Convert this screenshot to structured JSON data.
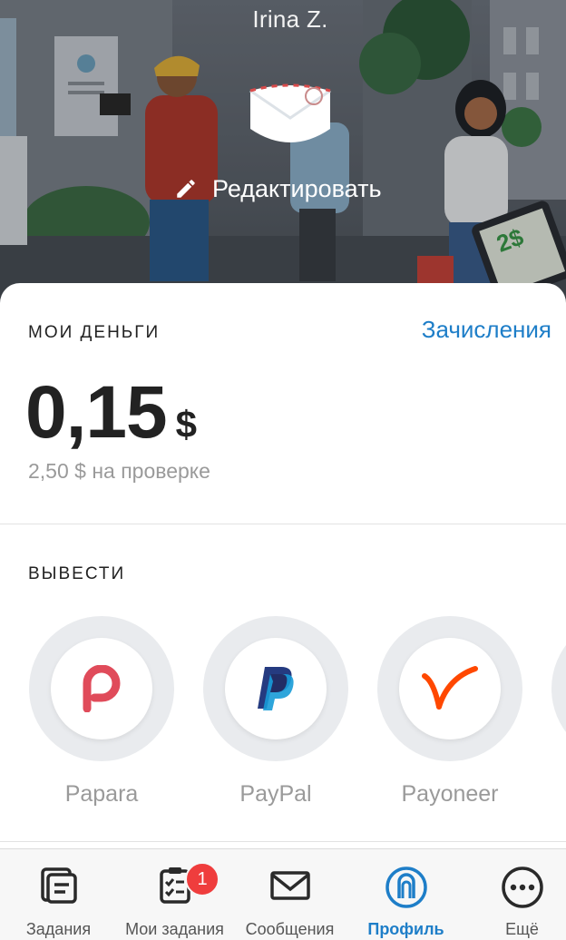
{
  "profile": {
    "name": "Irina Z.",
    "edit_label": "Редактировать"
  },
  "money": {
    "section_title": "МОИ ДЕНЬГИ",
    "accruals_link": "Зачисления",
    "balance_amount": "0,15",
    "balance_currency": "$",
    "pending_text": "2,50 $ на проверке"
  },
  "withdraw": {
    "section_title": "ВЫВЕСТИ",
    "methods": [
      {
        "name": "Papara",
        "icon": "papara-logo-icon",
        "color": "#e04b5a"
      },
      {
        "name": "PayPal",
        "icon": "paypal-logo-icon",
        "color": "#253b80"
      },
      {
        "name": "Payoneer",
        "icon": "payoneer-logo-icon",
        "color": "#ff4800"
      }
    ]
  },
  "nav": {
    "items": [
      {
        "label": "Задания",
        "icon": "tasks-icon"
      },
      {
        "label": "Мои задания",
        "icon": "my-tasks-icon",
        "badge": "1"
      },
      {
        "label": "Сообщения",
        "icon": "envelope-icon"
      },
      {
        "label": "Профиль",
        "icon": "profile-icon",
        "active": true
      },
      {
        "label": "Ещё",
        "icon": "more-icon"
      }
    ]
  },
  "colors": {
    "accent": "#1e7ec8",
    "badge": "#ef3d3d",
    "muted_text": "#9a9a9a"
  }
}
